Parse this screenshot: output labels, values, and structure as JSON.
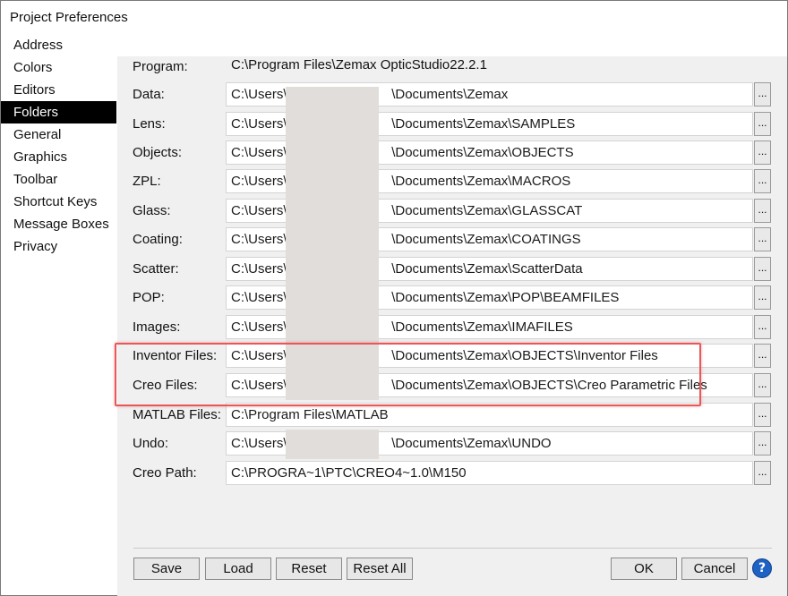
{
  "window": {
    "title": "Project Preferences"
  },
  "sidebar": {
    "items": [
      {
        "label": "Address"
      },
      {
        "label": "Colors"
      },
      {
        "label": "Editors"
      },
      {
        "label": "Folders",
        "active": true
      },
      {
        "label": "General"
      },
      {
        "label": "Graphics"
      },
      {
        "label": "Toolbar"
      },
      {
        "label": "Shortcut Keys"
      },
      {
        "label": "Message Boxes"
      },
      {
        "label": "Privacy"
      }
    ]
  },
  "folders": {
    "program": {
      "label": "Program:",
      "value": "C:\\Program Files\\Zemax OpticStudio22.2.1"
    },
    "rows": [
      {
        "label": "Data:",
        "value": "C:\\Users\\                            \\Documents\\Zemax"
      },
      {
        "label": "Lens:",
        "value": "C:\\Users\\                            \\Documents\\Zemax\\SAMPLES"
      },
      {
        "label": "Objects:",
        "value": "C:\\Users\\                            \\Documents\\Zemax\\OBJECTS"
      },
      {
        "label": "ZPL:",
        "value": "C:\\Users\\                            \\Documents\\Zemax\\MACROS"
      },
      {
        "label": "Glass:",
        "value": "C:\\Users\\                            \\Documents\\Zemax\\GLASSCAT"
      },
      {
        "label": "Coating:",
        "value": "C:\\Users\\                            \\Documents\\Zemax\\COATINGS"
      },
      {
        "label": "Scatter:",
        "value": "C:\\Users\\                            \\Documents\\Zemax\\ScatterData"
      },
      {
        "label": "POP:",
        "value": "C:\\Users\\                            \\Documents\\Zemax\\POP\\BEAMFILES"
      },
      {
        "label": "Images:",
        "value": "C:\\Users\\                            \\Documents\\Zemax\\IMAFILES"
      },
      {
        "label": "Inventor Files:",
        "value": "C:\\Users\\                            \\Documents\\Zemax\\OBJECTS\\Inventor Files"
      },
      {
        "label": "Creo Files:",
        "value": "C:\\Users\\                            \\Documents\\Zemax\\OBJECTS\\Creo Parametric Files"
      },
      {
        "label": "MATLAB Files:",
        "value": "C:\\Program Files\\MATLAB"
      },
      {
        "label": "Undo:",
        "value": "C:\\Users\\                            \\Documents\\Zemax\\UNDO"
      },
      {
        "label": "Creo Path:",
        "value": "C:\\PROGRA~1\\PTC\\CREO4~1.0\\M150"
      }
    ],
    "browse_label": "..."
  },
  "buttons": {
    "save": "Save",
    "load": "Load",
    "reset": "Reset",
    "reset_all": "Reset All",
    "ok": "OK",
    "cancel": "Cancel",
    "help": "?"
  },
  "colors": {
    "active_nav_bg": "#000000",
    "panel_bg": "#f0f0f0",
    "highlight": "#e8585a",
    "help_blue": "#1e62c4"
  }
}
